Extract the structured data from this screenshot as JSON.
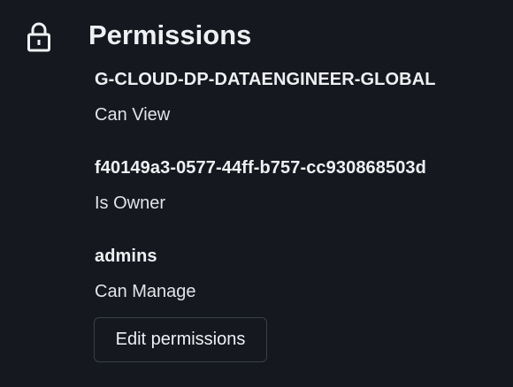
{
  "section": {
    "title": "Permissions",
    "icon": "lock-icon"
  },
  "permissions": [
    {
      "principal": "G-CLOUD-DP-DATAENGINEER-GLOBAL",
      "level": "Can View"
    },
    {
      "principal": "f40149a3-0577-44ff-b757-cc930868503d",
      "level": "Is Owner"
    },
    {
      "principal": "admins",
      "level": "Can Manage"
    }
  ],
  "actions": {
    "edit_label": "Edit permissions"
  },
  "colors": {
    "background": "#15181f",
    "text": "#eef0f2",
    "button_border": "#3a3f48"
  }
}
